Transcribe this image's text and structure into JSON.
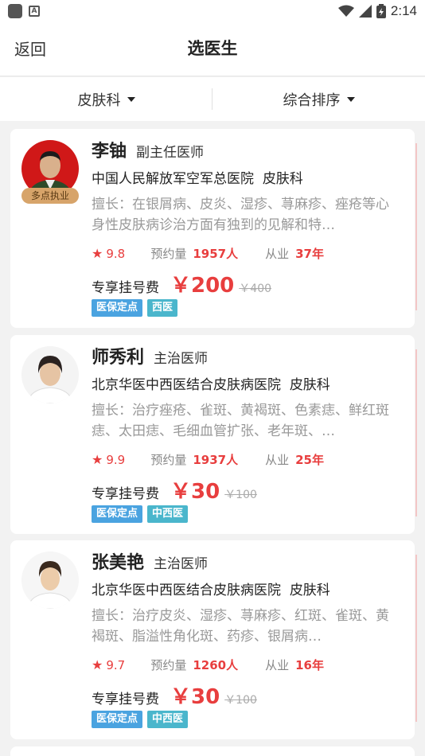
{
  "status_bar": {
    "time": "2:14"
  },
  "header": {
    "back_label": "返回",
    "title": "选医生"
  },
  "filters": {
    "department": "皮肤科",
    "sort": "综合排序"
  },
  "doctors": [
    {
      "name": "李铀",
      "title": "副主任医师",
      "hospital": "中国人民解放军空军总医院",
      "department": "皮肤科",
      "badge": "多点执业",
      "specialty": "擅长：在银屑病、皮炎、湿疹、荨麻疹、痤疮等心身性皮肤病诊治方面有独到的见解和特…",
      "rating": "9.8",
      "appointments_label": "预约量",
      "appointments": "1957人",
      "practice_label": "从业",
      "years": "37年",
      "fee_label": "专享挂号费",
      "fee": "￥200",
      "fee_original": "￥400",
      "tags": [
        "医保定点",
        "西医"
      ]
    },
    {
      "name": "师秀利",
      "title": "主治医师",
      "hospital": "北京华医中西医结合皮肤病医院",
      "department": "皮肤科",
      "specialty": "擅长：治疗痤疮、雀斑、黄褐斑、色素痣、鲜红斑痣、太田痣、毛细血管扩张、老年斑、…",
      "rating": "9.9",
      "appointments_label": "预约量",
      "appointments": "1937人",
      "practice_label": "从业",
      "years": "25年",
      "fee_label": "专享挂号费",
      "fee": "￥30",
      "fee_original": "￥100",
      "tags": [
        "医保定点",
        "中西医"
      ]
    },
    {
      "name": "张美艳",
      "title": "主治医师",
      "hospital": "北京华医中西医结合皮肤病医院",
      "department": "皮肤科",
      "specialty": "擅长：治疗皮炎、湿疹、荨麻疹、红斑、雀斑、黄褐斑、脂溢性角化斑、药疹、银屑病…",
      "rating": "9.7",
      "appointments_label": "预约量",
      "appointments": "1260人",
      "practice_label": "从业",
      "years": "16年",
      "fee_label": "专享挂号费",
      "fee": "￥30",
      "fee_original": "￥100",
      "tags": [
        "医保定点",
        "中西医"
      ]
    }
  ],
  "colors": {
    "accent_red": "#e83e3e",
    "tag_blue": "#4aa3e0",
    "tag_teal": "#4ab6cc",
    "badge_gold": "#d7a46a"
  }
}
